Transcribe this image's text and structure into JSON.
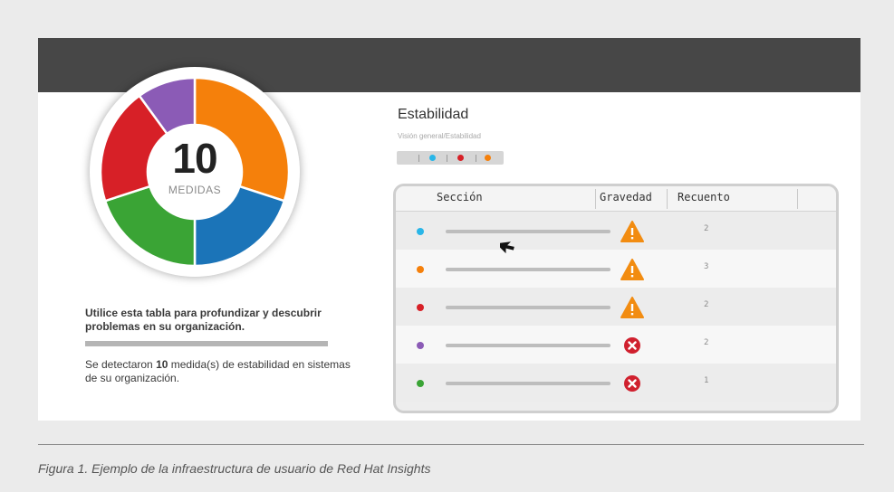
{
  "donut": {
    "count": "10",
    "label": "MEDIDAS",
    "segments": [
      {
        "category": "orange",
        "color": "#f5800b",
        "value": 3
      },
      {
        "category": "blue",
        "color": "#1b74b8",
        "value": 2
      },
      {
        "category": "green",
        "color": "#3aa435",
        "value": 2
      },
      {
        "category": "red",
        "color": "#d72027",
        "value": 2
      },
      {
        "category": "purple",
        "color": "#8b5bb6",
        "value": 1
      }
    ]
  },
  "left_panel": {
    "help_text": "Utilice esta tabla para profundizar y descubrir problemas en su organización.",
    "detect_prefix": "Se detectaron ",
    "detect_count": "10",
    "detect_suffix": " medida(s) de estabilidad en sistemas de su organización."
  },
  "page": {
    "title": "Estabilidad",
    "breadcrumb": "Visión general/Estabilidad"
  },
  "filter": {
    "dots": [
      {
        "color": "#29b6e8"
      },
      {
        "color": "#d72027"
      },
      {
        "color": "#f5800b"
      }
    ]
  },
  "table": {
    "headers": {
      "section": "Sección",
      "severity": "Gravedad",
      "count": "Recuento"
    },
    "rows": [
      {
        "dot_color": "#29b6e8",
        "severity_icon": "warning-triangle-icon",
        "count": "2"
      },
      {
        "dot_color": "#f5800b",
        "severity_icon": "warning-triangle-icon",
        "count": "3"
      },
      {
        "dot_color": "#d72027",
        "severity_icon": "warning-triangle-icon",
        "count": "2"
      },
      {
        "dot_color": "#8b5bb6",
        "severity_icon": "error-x-circle-icon",
        "count": "2"
      },
      {
        "dot_color": "#3aa435",
        "severity_icon": "error-x-circle-icon",
        "count": "1"
      }
    ]
  },
  "caption": "Figura 1. Ejemplo de la infraestructura de usuario de Red Hat Insights",
  "colors": {
    "header_bar": "#474747",
    "warning": "#f28c11",
    "error": "#d0202e"
  }
}
